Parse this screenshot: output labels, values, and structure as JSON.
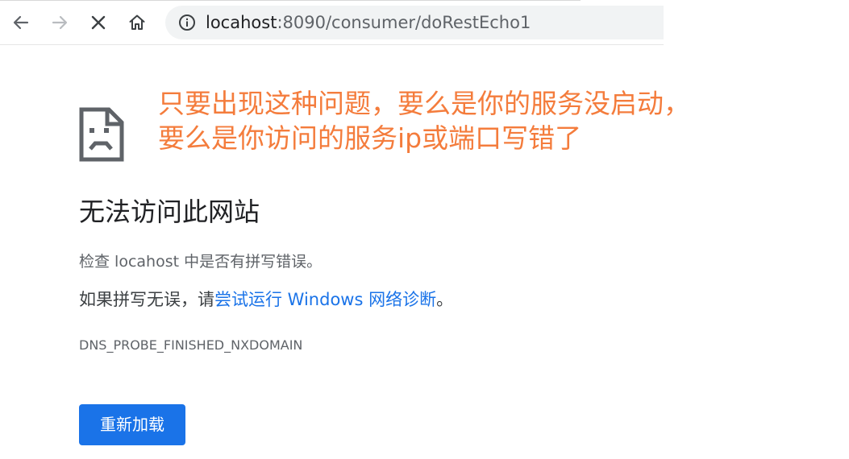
{
  "browser": {
    "url_host": "locahost",
    "url_rest": ":8090/consumer/doRestEcho1",
    "icons": {
      "back": "arrow-left-icon",
      "forward": "arrow-right-icon",
      "stop": "close-icon",
      "home": "home-icon",
      "site_info": "info-icon"
    }
  },
  "annotation": {
    "line1": "只要出现这种问题，要么是你的服务没启动，",
    "line2": "要么是你访问的服务ip或端口写错了",
    "color": "#f47c3c"
  },
  "error": {
    "icon": "broken-page-icon",
    "heading": "无法访问此网站",
    "check_text": "检查 locahost 中是否有拼写错误。",
    "suggest_prefix": "如果拼写无误，请",
    "suggest_link": "尝试运行 Windows 网络诊断",
    "suggest_suffix": "。",
    "code": "DNS_PROBE_FINISHED_NXDOMAIN",
    "reload_label": "重新加载"
  },
  "colors": {
    "link": "#1a73e8",
    "button": "#1a73e8",
    "annotation": "#f47c3c"
  }
}
